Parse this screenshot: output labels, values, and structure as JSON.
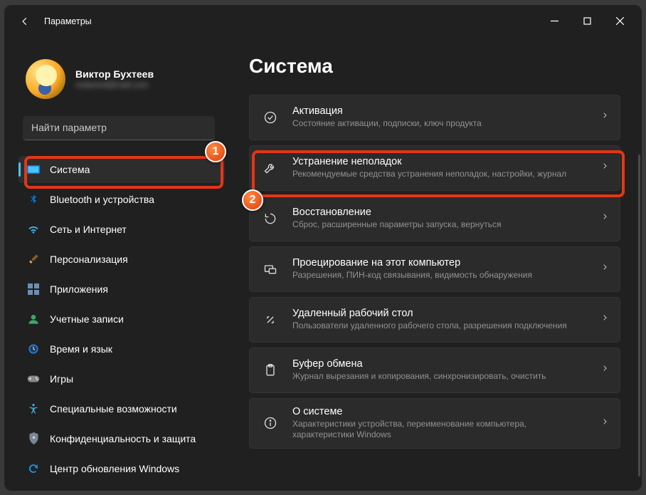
{
  "window": {
    "title": "Параметры"
  },
  "profile": {
    "name": "Виктор Бухтеев",
    "email": "redacted@mail.com"
  },
  "search": {
    "placeholder": "Найти параметр"
  },
  "sidebar": {
    "items": [
      {
        "label": "Система",
        "icon": "system",
        "selected": true
      },
      {
        "label": "Bluetooth и устройства",
        "icon": "bluetooth"
      },
      {
        "label": "Сеть и Интернет",
        "icon": "wifi"
      },
      {
        "label": "Персонализация",
        "icon": "brush"
      },
      {
        "label": "Приложения",
        "icon": "apps"
      },
      {
        "label": "Учетные записи",
        "icon": "account"
      },
      {
        "label": "Время и язык",
        "icon": "time"
      },
      {
        "label": "Игры",
        "icon": "gaming"
      },
      {
        "label": "Специальные возможности",
        "icon": "accessibility"
      },
      {
        "label": "Конфиденциальность и защита",
        "icon": "privacy"
      },
      {
        "label": "Центр обновления Windows",
        "icon": "update"
      }
    ]
  },
  "main": {
    "heading": "Система",
    "cards": [
      {
        "title": "Активация",
        "desc": "Состояние активации, подписки, ключ продукта",
        "icon": "activation"
      },
      {
        "title": "Устранение неполадок",
        "desc": "Рекомендуемые средства устранения неполадок, настройки, журнал",
        "icon": "troubleshoot",
        "highlighted": true
      },
      {
        "title": "Восстановление",
        "desc": "Сброс, расширенные параметры запуска, вернуться",
        "icon": "recovery"
      },
      {
        "title": "Проецирование на этот компьютер",
        "desc": "Разрешения, ПИН-код связывания, видимость обнаружения",
        "icon": "projection"
      },
      {
        "title": "Удаленный рабочий стол",
        "desc": "Пользователи удаленного рабочего стола, разрешения подключения",
        "icon": "remote"
      },
      {
        "title": "Буфер обмена",
        "desc": "Журнал вырезания и копирования, синхронизировать, очистить",
        "icon": "clipboard"
      },
      {
        "title": "О системе",
        "desc": "Характеристики устройства, переименование компьютера, характеристики Windows",
        "icon": "about"
      }
    ]
  },
  "annotations": {
    "step1": "1",
    "step2": "2"
  }
}
